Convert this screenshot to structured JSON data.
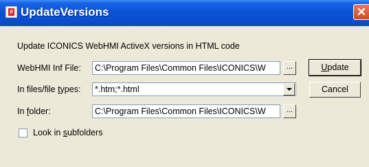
{
  "window": {
    "title": "UpdateVersions",
    "close_glyph": "✕"
  },
  "description": "Update ICONICS WebHMI ActiveX versions in HTML code",
  "inf_file": {
    "label_pre": "WebHMI Inf File:",
    "value": "C:\\Program Files\\Common Files\\ICONICS\\W",
    "browse_label": "..."
  },
  "file_types": {
    "label_pre": "In files/file ",
    "label_accel": "t",
    "label_post": "ypes:",
    "value": "*.htm;*.html"
  },
  "folder": {
    "label_pre": "In ",
    "label_accel": "f",
    "label_post": "older:",
    "value": "C:\\Program Files\\Common Files\\ICONICS\\W",
    "browse_label": "..."
  },
  "subfolders": {
    "label_pre": "Look in ",
    "label_accel": "s",
    "label_post": "ubfolders",
    "checked": false
  },
  "buttons": {
    "update_accel": "U",
    "update_rest": "pdate",
    "cancel": "Cancel"
  },
  "icons": {
    "app": "app-icon",
    "close": "close-icon",
    "dropdown": "chevron-down-icon"
  }
}
